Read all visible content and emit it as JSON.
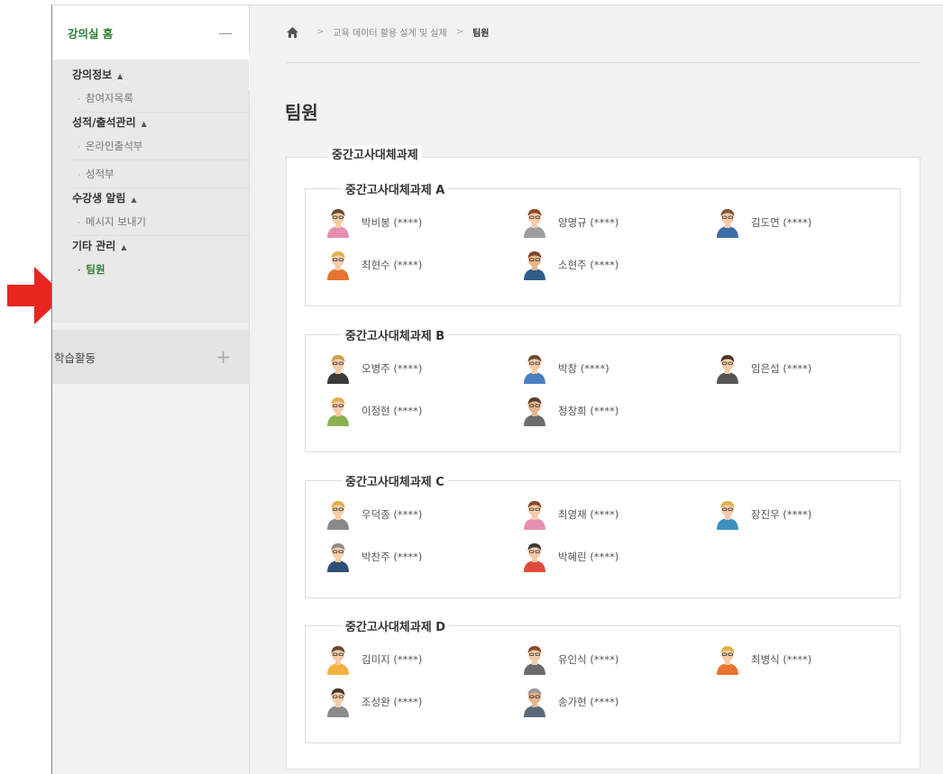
{
  "sidebar": {
    "home_title": "강의실 홈",
    "collapse_symbol": "—",
    "groups": [
      {
        "title": "강의정보",
        "caret": "▲",
        "items": [
          {
            "label": "참여자목록",
            "bullet": "·"
          }
        ]
      },
      {
        "title": "성적/출석관리",
        "caret": "▲",
        "items": [
          {
            "label": "온라인출석부",
            "bullet": "·"
          },
          {
            "label": "성적부",
            "bullet": "·"
          }
        ]
      },
      {
        "title": "수강생 알림",
        "caret": "▲",
        "items": [
          {
            "label": "메시지 보내기",
            "bullet": "·"
          }
        ]
      },
      {
        "title": "기타 관리",
        "caret": "▲",
        "items": [
          {
            "label": "팀원",
            "bullet": "·",
            "active": true
          }
        ]
      }
    ],
    "learning_title": "학습활동",
    "learning_add": "+",
    "collapse_tab": "◀"
  },
  "breadcrumb": {
    "home_icon": "home-icon",
    "separator": ">",
    "course": "교육 데이터 활용 설계 및 실제",
    "current": "팀원"
  },
  "page_title": "팀원",
  "panel": {
    "legend": "중간고사대체과제",
    "groups": [
      {
        "name": "중간고사대체과제 A",
        "members": [
          {
            "name": "박비봉 (****)",
            "shirt": "#e58fb0",
            "hair": "#6d4c2f",
            "skin": "#f5cba7"
          },
          {
            "name": "양명규 (****)",
            "shirt": "#9e9e9e",
            "hair": "#8b4a2b",
            "skin": "#f5cba7"
          },
          {
            "name": "김도연 (****)",
            "shirt": "#3d6ea8",
            "hair": "#7b5a3a",
            "skin": "#f5cba7"
          },
          {
            "name": "최현수 (****)",
            "shirt": "#e8742f",
            "hair": "#e0b04a",
            "skin": "#f5cba7"
          },
          {
            "name": "소현주 (****)",
            "shirt": "#2f5d8a",
            "hair": "#7a4a2a",
            "skin": "#e9b48a"
          }
        ]
      },
      {
        "name": "중간고사대체과제 B",
        "members": [
          {
            "name": "오병주 (****)",
            "shirt": "#3a3a3a",
            "hair": "#caa24a",
            "skin": "#f5cba7"
          },
          {
            "name": "박창 (****)",
            "shirt": "#4a7fc0",
            "hair": "#6d4c2f",
            "skin": "#f5cba7"
          },
          {
            "name": "임은섭 (****)",
            "shirt": "#555555",
            "hair": "#4a3525",
            "skin": "#f5cba7"
          },
          {
            "name": "이정현 (****)",
            "shirt": "#8bb050",
            "hair": "#e0b04a",
            "skin": "#f5cba7"
          },
          {
            "name": "정창희 (****)",
            "shirt": "#6d6d6d",
            "hair": "#5a3e2a",
            "skin": "#e9b48a"
          }
        ]
      },
      {
        "name": "중간고사대체과제 C",
        "members": [
          {
            "name": "우덕종 (****)",
            "shirt": "#8a8a8a",
            "hair": "#e0b04a",
            "skin": "#f5cba7"
          },
          {
            "name": "최영재 (****)",
            "shirt": "#e58fb0",
            "hair": "#8b4a2b",
            "skin": "#f5cba7"
          },
          {
            "name": "장진우 (****)",
            "shirt": "#3d8fc0",
            "hair": "#e0b04a",
            "skin": "#f5cba7"
          },
          {
            "name": "박찬주 (****)",
            "shirt": "#2f4f7a",
            "hair": "#8a8a8a",
            "skin": "#f5cba7"
          },
          {
            "name": "박혜린 (****)",
            "shirt": "#e04a3a",
            "hair": "#3a3a3a",
            "skin": "#f5cba7"
          }
        ]
      },
      {
        "name": "중간고사대체과제 D",
        "members": [
          {
            "name": "김미지 (****)",
            "shirt": "#f2b440",
            "hair": "#6d4c2f",
            "skin": "#f5cba7"
          },
          {
            "name": "유인식 (****)",
            "shirt": "#6a6a6a",
            "hair": "#8b4a2b",
            "skin": "#f5cba7"
          },
          {
            "name": "최병식 (****)",
            "shirt": "#e8742f",
            "hair": "#e0b04a",
            "skin": "#f5cba7"
          },
          {
            "name": "조성완 (****)",
            "shirt": "#8a8a8a",
            "hair": "#4a3525",
            "skin": "#f5cba7"
          },
          {
            "name": "송가현 (****)",
            "shirt": "#5a6a7a",
            "hair": "#9a9a9a",
            "skin": "#e9b48a"
          }
        ]
      }
    ]
  },
  "colors": {
    "accent_green": "#2e7d32",
    "indicator_red": "#e8251f"
  }
}
